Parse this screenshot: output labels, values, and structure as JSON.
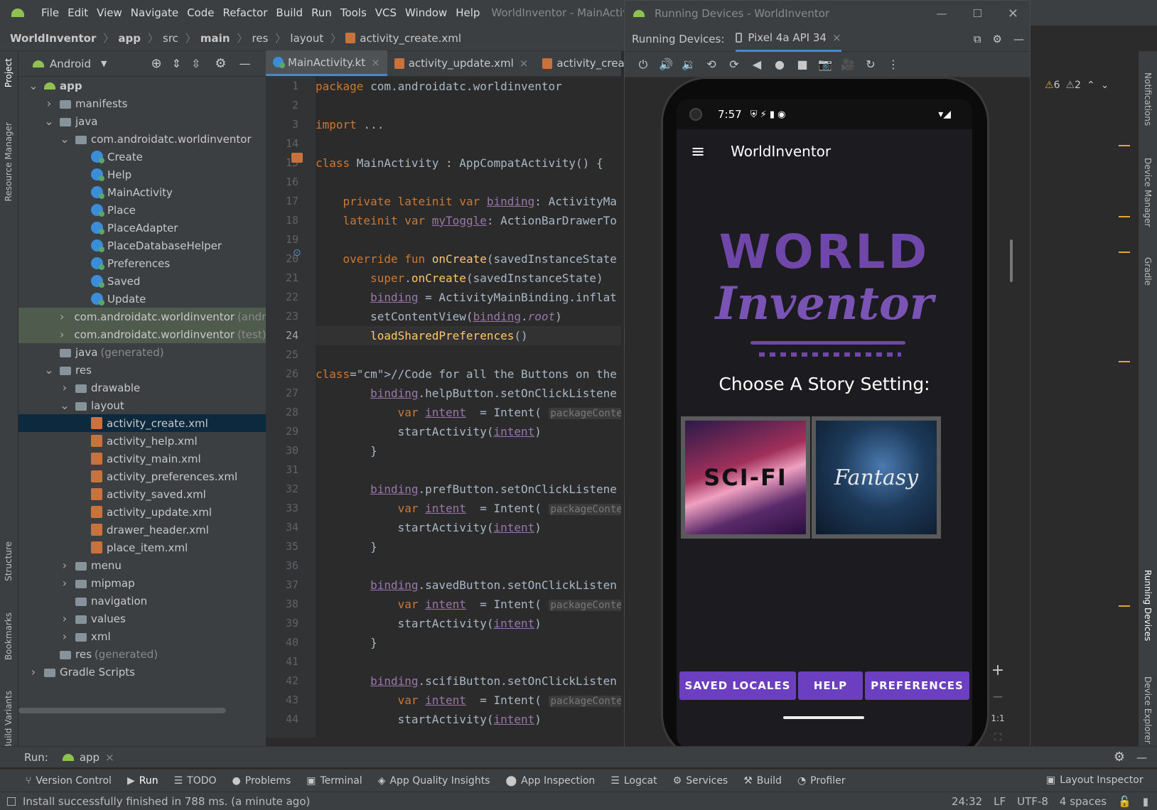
{
  "menu": {
    "items": [
      "File",
      "Edit",
      "View",
      "Navigate",
      "Code",
      "Refactor",
      "Build",
      "Run",
      "Tools",
      "VCS",
      "Window",
      "Help"
    ],
    "window_title": "WorldInventor - MainActivit"
  },
  "breadcrumb": [
    "WorldInventor",
    "app",
    "src",
    "main",
    "res",
    "layout",
    "activity_create.xml"
  ],
  "project_panel": {
    "mode_label": "Android",
    "tree": [
      {
        "label": "app",
        "indent": 0,
        "icon": "android",
        "chev": "v",
        "bold": true
      },
      {
        "label": "manifests",
        "indent": 1,
        "icon": "folder",
        "chev": ">"
      },
      {
        "label": "java",
        "indent": 1,
        "icon": "folder",
        "chev": "v"
      },
      {
        "label": "com.androidatc.worldinventor",
        "indent": 2,
        "icon": "folder",
        "chev": "v"
      },
      {
        "label": "Create",
        "indent": 3,
        "icon": "kt"
      },
      {
        "label": "Help",
        "indent": 3,
        "icon": "kt"
      },
      {
        "label": "MainActivity",
        "indent": 3,
        "icon": "kt"
      },
      {
        "label": "Place",
        "indent": 3,
        "icon": "kt"
      },
      {
        "label": "PlaceAdapter",
        "indent": 3,
        "icon": "kt"
      },
      {
        "label": "PlaceDatabaseHelper",
        "indent": 3,
        "icon": "kt"
      },
      {
        "label": "Preferences",
        "indent": 3,
        "icon": "kt"
      },
      {
        "label": "Saved",
        "indent": 3,
        "icon": "kt"
      },
      {
        "label": "Update",
        "indent": 3,
        "icon": "kt"
      },
      {
        "label": "com.androidatc.worldinventor",
        "suffix": "(andro",
        "indent": 2,
        "icon": "folder",
        "chev": ">",
        "hl": "green"
      },
      {
        "label": "com.androidatc.worldinventor",
        "suffix": "(test)",
        "indent": 2,
        "icon": "folder",
        "chev": ">",
        "hl": "green"
      },
      {
        "label": "java",
        "suffix": "(generated)",
        "indent": 1,
        "icon": "folder"
      },
      {
        "label": "res",
        "indent": 1,
        "icon": "folder",
        "chev": "v"
      },
      {
        "label": "drawable",
        "indent": 2,
        "icon": "folder",
        "chev": ">"
      },
      {
        "label": "layout",
        "indent": 2,
        "icon": "folder",
        "chev": "v"
      },
      {
        "label": "activity_create.xml",
        "indent": 3,
        "icon": "xml",
        "hl": "sel"
      },
      {
        "label": "activity_help.xml",
        "indent": 3,
        "icon": "xml"
      },
      {
        "label": "activity_main.xml",
        "indent": 3,
        "icon": "xml"
      },
      {
        "label": "activity_preferences.xml",
        "indent": 3,
        "icon": "xml"
      },
      {
        "label": "activity_saved.xml",
        "indent": 3,
        "icon": "xml"
      },
      {
        "label": "activity_update.xml",
        "indent": 3,
        "icon": "xml"
      },
      {
        "label": "drawer_header.xml",
        "indent": 3,
        "icon": "xml"
      },
      {
        "label": "place_item.xml",
        "indent": 3,
        "icon": "xml"
      },
      {
        "label": "menu",
        "indent": 2,
        "icon": "folder",
        "chev": ">"
      },
      {
        "label": "mipmap",
        "indent": 2,
        "icon": "folder",
        "chev": ">"
      },
      {
        "label": "navigation",
        "indent": 2,
        "icon": "folder"
      },
      {
        "label": "values",
        "indent": 2,
        "icon": "folder",
        "chev": ">"
      },
      {
        "label": "xml",
        "indent": 2,
        "icon": "folder",
        "chev": ">"
      },
      {
        "label": "res",
        "suffix": "(generated)",
        "indent": 1,
        "icon": "folder"
      },
      {
        "label": "Gradle Scripts",
        "indent": 0,
        "icon": "gradle",
        "chev": ">"
      }
    ]
  },
  "left_tool_windows": [
    "Project",
    "Resource Manager",
    "Structure",
    "Bookmarks",
    "Build Variants"
  ],
  "right_tool_windows": [
    "Notifications",
    "Device Manager",
    "Gradle",
    "Running Devices",
    "Device Explorer"
  ],
  "editor_tabs": [
    "MainActivity.kt",
    "activity_update.xml",
    "activity_create.xml"
  ],
  "editor": {
    "line_numbers": [
      "1",
      "2",
      "3",
      "14",
      "15",
      "16",
      "17",
      "18",
      "19",
      "20",
      "21",
      "22",
      "23",
      "24",
      "25",
      "26",
      "27",
      "28",
      "29",
      "30",
      "31",
      "32",
      "33",
      "34",
      "35",
      "36",
      "37",
      "38",
      "39",
      "40",
      "41",
      "42",
      "43",
      "44"
    ],
    "current_line": "24",
    "warnings": "6",
    "weak_warnings": "2",
    "code": [
      "package com.androidatc.worldinventor",
      "",
      "import ...",
      "",
      "class MainActivity : AppCompatActivity() {",
      "",
      "    private lateinit var binding: ActivityMa",
      "    lateinit var myToggle: ActionBarDrawerTo",
      "",
      "    override fun onCreate(savedInstanceState",
      "        super.onCreate(savedInstanceState)",
      "        binding = ActivityMainBinding.inflat",
      "        setContentView(binding.root)",
      "        loadSharedPreferences()",
      "",
      "//Code for all the Buttons on the Main Page",
      "        binding.helpButton.setOnClickListene",
      "            var intent  = Intent( packageContex",
      "            startActivity(intent)",
      "        }",
      "",
      "        binding.prefButton.setOnClickListene",
      "            var intent  = Intent( packageContex",
      "            startActivity(intent)",
      "        }",
      "",
      "        binding.savedButton.setOnClickListen",
      "            var intent  = Intent( packageContex",
      "            startActivity(intent)",
      "        }",
      "",
      "        binding.scifiButton.setOnClickListen",
      "            var intent  = Intent( packageContex",
      "            startActivity(intent)"
    ]
  },
  "running_devices": {
    "title": "Running Devices - WorldInventor",
    "label": "Running Devices:",
    "device_tab": "Pixel 4a API 34",
    "zoom_label": "1:1"
  },
  "phone": {
    "time": "7:57",
    "app_title": "WorldInventor",
    "logo_line1": "WORLD",
    "logo_line2": "Inventor",
    "choose_text": "Choose A Story Setting:",
    "scifi_label": "SCI-FI",
    "fantasy_label": "Fantasy",
    "buttons": [
      "SAVED LOCALES",
      "HELP",
      "PREFERENCES"
    ]
  },
  "run_bar": {
    "label": "Run:",
    "config": "app"
  },
  "bottom_tools": [
    "Version Control",
    "Run",
    "TODO",
    "Problems",
    "Terminal",
    "App Quality Insights",
    "App Inspection",
    "Logcat",
    "Services",
    "Build",
    "Profiler"
  ],
  "layout_inspector": "Layout Inspector",
  "status": {
    "message": "Install successfully finished in 788 ms. (a minute ago)",
    "position": "24:32",
    "line_sep": "LF",
    "encoding": "UTF-8",
    "indent": "4 spaces"
  },
  "colors": {
    "accent": "#4a88c7",
    "brand_purple": "#6b3fc0",
    "ide_bg": "#2b2b2b"
  }
}
